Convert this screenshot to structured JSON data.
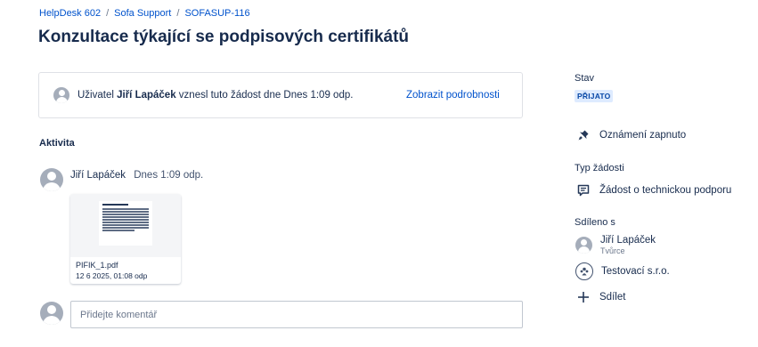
{
  "breadcrumb": {
    "items": [
      "HelpDesk 602",
      "Sofa Support",
      "SOFASUP-116"
    ],
    "separator": "/"
  },
  "request": {
    "title": "Konzultace týkající se podpisových certifikátů",
    "raised_prefix": "Uživatel",
    "raised_user": "Jiří Lapáček",
    "raised_suffix": "vznesl tuto žádost dne Dnes 1:09 odp.",
    "details_link": "Zobrazit podrobnosti"
  },
  "activity": {
    "label": "Aktivita",
    "comment": {
      "author": "Jiří Lapáček",
      "time": "Dnes 1:09 odp.",
      "attachment": {
        "filename": "PIFIK_1.pdf",
        "date": "12 6 2025, 01:08 odp"
      }
    },
    "add_comment_placeholder": "Přidejte komentář"
  },
  "sidebar": {
    "status_label": "Stav",
    "status_value": "PŘIJATO",
    "notifications": "Oznámení zapnuto",
    "request_type_label": "Typ žádosti",
    "request_type_value": "Žádost o technickou podporu",
    "shared_label": "Sdíleno s",
    "shared_with": [
      {
        "name": "Jiří Lapáček",
        "role": "Tvůrce"
      },
      {
        "name": "Testovací s.r.o.",
        "role": ""
      }
    ],
    "share_button": "Sdílet"
  },
  "colors": {
    "link": "#0052cc",
    "text": "#172b4d",
    "status_bg": "#deebff",
    "status_text": "#0747a6",
    "avatar": "#a5adba"
  },
  "icons": [
    "user-avatar-icon",
    "bell-icon",
    "request-type-icon",
    "organization-icon",
    "plus-icon"
  ]
}
